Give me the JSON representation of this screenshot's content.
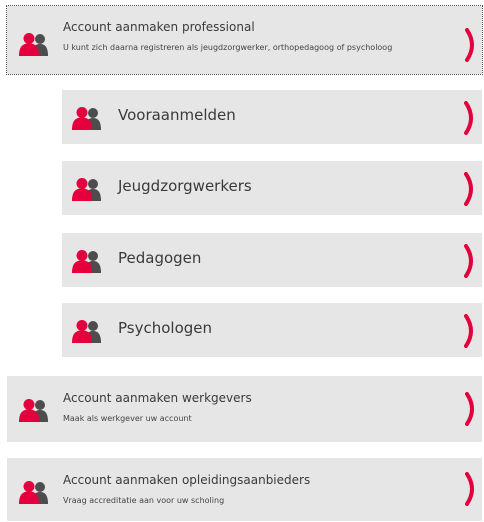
{
  "colors": {
    "accent": "#e3003d",
    "icon_dark": "#4d4d4d",
    "row_bg": "#e6e6e6"
  },
  "items": [
    {
      "title": "Account aanmaken professional",
      "subtitle": "U kunt zich daarna registreren als jeugdzorgwerker, orthopedagoog of psycholoog",
      "icon": "users-icon",
      "chevron": "chevron-right-icon",
      "focused": true
    },
    {
      "title": "Vooraanmelden",
      "icon": "users-icon",
      "chevron": "chevron-right-icon"
    },
    {
      "title": "Jeugdzorgwerkers",
      "icon": "users-icon",
      "chevron": "chevron-right-icon"
    },
    {
      "title": "Pedagogen",
      "icon": "users-icon",
      "chevron": "chevron-right-icon"
    },
    {
      "title": "Psychologen",
      "icon": "users-icon",
      "chevron": "chevron-right-icon"
    },
    {
      "title": "Account aanmaken werkgevers",
      "subtitle": "Maak als werkgever uw account",
      "icon": "users-icon",
      "chevron": "chevron-right-icon"
    },
    {
      "title": "Account aanmaken opleidingsaanbieders",
      "subtitle": "Vraag accreditatie aan voor uw scholing",
      "icon": "users-icon",
      "chevron": "chevron-right-icon"
    }
  ]
}
